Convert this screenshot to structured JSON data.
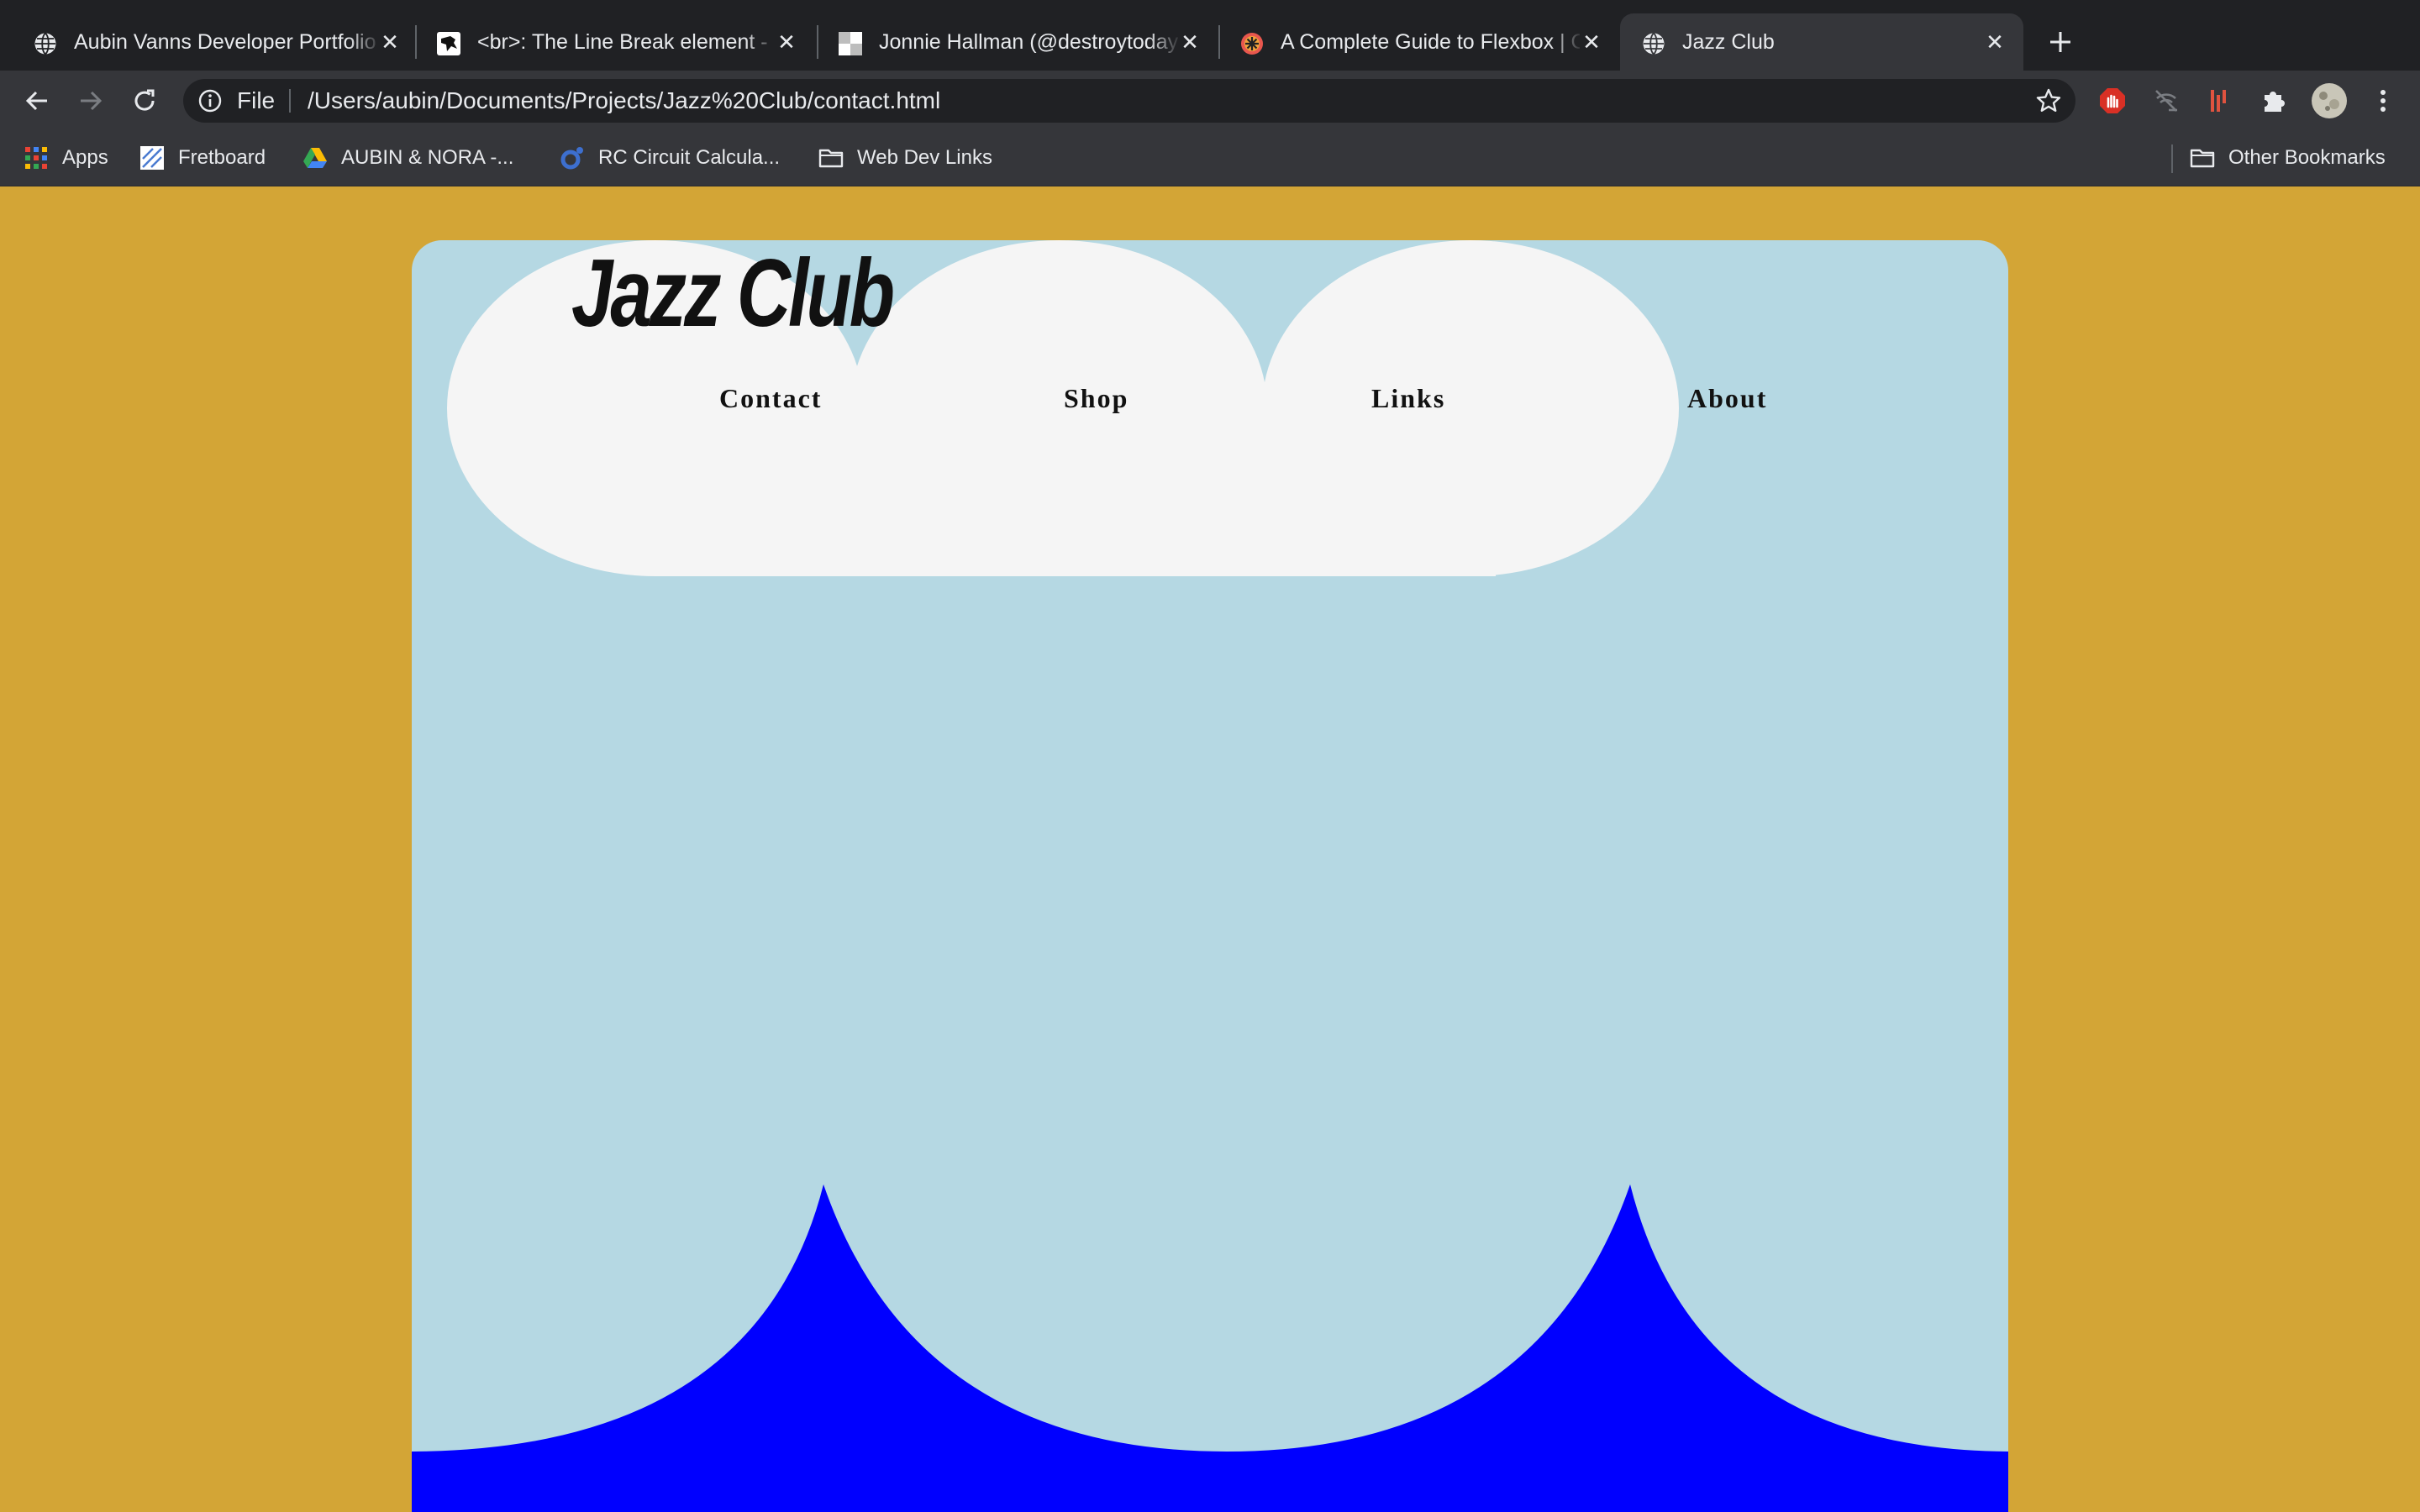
{
  "browser": {
    "tabs": [
      {
        "title": "Aubin Vanns Developer Portfolio",
        "favicon": "globe-icon",
        "active": false
      },
      {
        "title": "<br>: The Line Break element - HTML",
        "favicon": "mdn-dino-icon",
        "active": false
      },
      {
        "title": "Jonnie Hallman (@destroytoday)",
        "favicon": "checker-icon",
        "active": false
      },
      {
        "title": "A Complete Guide to Flexbox | CSS-Tricks",
        "favicon": "css-tricks-icon",
        "active": false
      },
      {
        "title": "Jazz Club",
        "favicon": "globe-icon",
        "active": true
      }
    ],
    "address": {
      "scheme_label": "File",
      "url": "/Users/aubin/Documents/Projects/Jazz%20Club/contact.html"
    },
    "bookmarks": [
      {
        "label": "Apps",
        "icon": "apps-grid-icon"
      },
      {
        "label": "Fretboard",
        "icon": "fretboard-icon"
      },
      {
        "label": "AUBIN & NORA -...",
        "icon": "google-drive-icon"
      },
      {
        "label": "RC Circuit Calcula...",
        "icon": "gear-icon"
      },
      {
        "label": "Web Dev Links",
        "icon": "folder-icon"
      }
    ],
    "other_bookmarks": "Other Bookmarks"
  },
  "page": {
    "brand": "Jazz Club",
    "nav": [
      "Contact",
      "Shop",
      "Links",
      "About"
    ],
    "colors": {
      "background": "#d3a536",
      "card": "#b5d8e3",
      "cloud": "#f5f5f5",
      "waves": "#0000ff"
    }
  }
}
